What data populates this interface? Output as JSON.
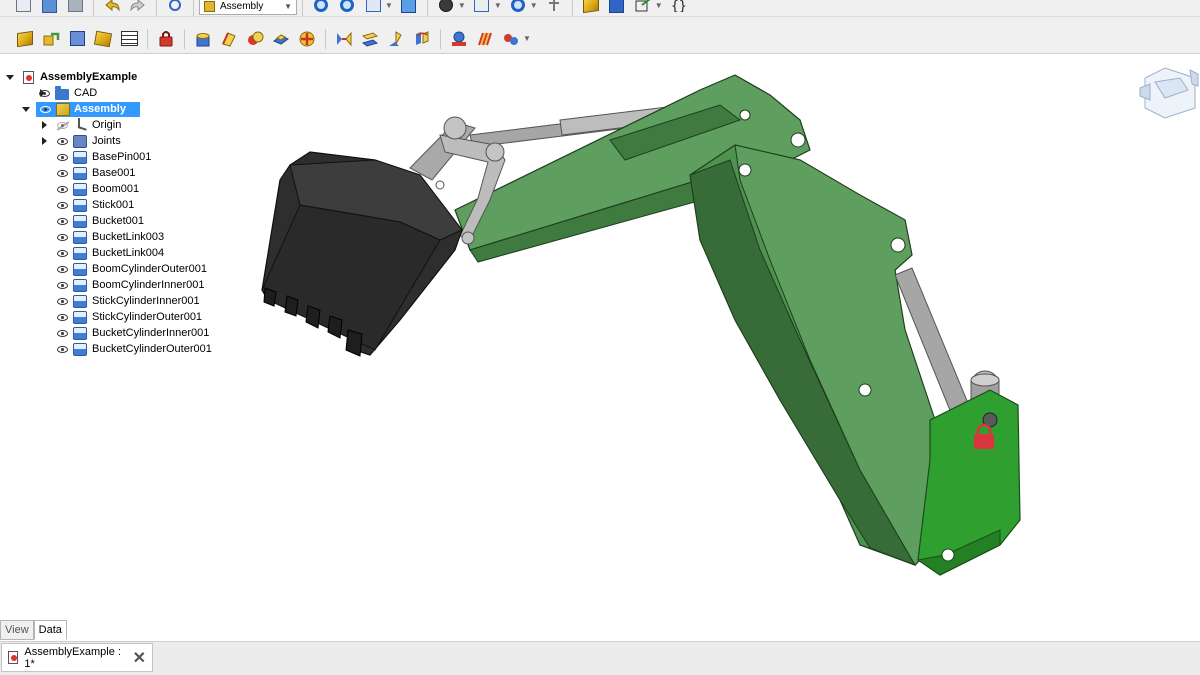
{
  "toolbar": {
    "workbench_selector": {
      "value": "Assembly"
    },
    "row1_icons": [
      "new-document-icon",
      "open-document-icon",
      "save-icon",
      "undo-icon",
      "redo-icon",
      "refresh-icon",
      "workbench-selector",
      "fit-all-icon",
      "fit-selection-icon",
      "view-box-icon",
      "std-view-icon",
      "draw-style-icon",
      "bounding-box-icon",
      "measure-icon",
      "link-icon",
      "part-icon",
      "body-icon",
      "external-link-icon",
      "macro-icon"
    ],
    "row2_icons": [
      "insert-component-icon",
      "insert-link-icon",
      "solve-assembly-icon",
      "exploded-view-icon",
      "bill-of-materials-icon",
      "toggle-grounded-icon",
      "fixed-joint-icon",
      "revolute-joint-icon",
      "cylindrical-joint-icon",
      "slider-joint-icon",
      "ball-joint-icon",
      "distance-joint-icon",
      "parallel-joint-icon",
      "perpendicular-joint-icon",
      "angle-joint-icon",
      "rack-pinion-icon",
      "screw-joint-icon",
      "gears-joint-icon",
      "belt-joint-icon"
    ]
  },
  "tree": {
    "root": {
      "label": "AssemblyExample"
    },
    "items": [
      {
        "label": "CAD",
        "icon": "folder"
      },
      {
        "label": "Assembly",
        "icon": "assembly"
      },
      {
        "label": "Origin",
        "icon": "origin"
      },
      {
        "label": "Joints",
        "icon": "joints"
      },
      {
        "label": "BasePin001"
      },
      {
        "label": "Base001"
      },
      {
        "label": "Boom001"
      },
      {
        "label": "Stick001"
      },
      {
        "label": "Bucket001"
      },
      {
        "label": "BucketLink003"
      },
      {
        "label": "BucketLink004"
      },
      {
        "label": "BoomCylinderOuter001"
      },
      {
        "label": "BoomCylinderInner001"
      },
      {
        "label": "StickCylinderInner001"
      },
      {
        "label": "StickCylinderOuter001"
      },
      {
        "label": "BucketCylinderInner001"
      },
      {
        "label": "BucketCylinderOuter001"
      }
    ]
  },
  "panel_tabs": {
    "view": "View",
    "data": "Data"
  },
  "document_tab": {
    "title": "AssemblyExample : 1*"
  },
  "colors": {
    "boom": "#5e9e5e",
    "stick": "#4f914f",
    "base": "#2f9f2f",
    "bucket": "#2e2e2e",
    "cylinder": "#a9a9a9",
    "selection": "#3399ff",
    "lock": "#d9363e"
  }
}
